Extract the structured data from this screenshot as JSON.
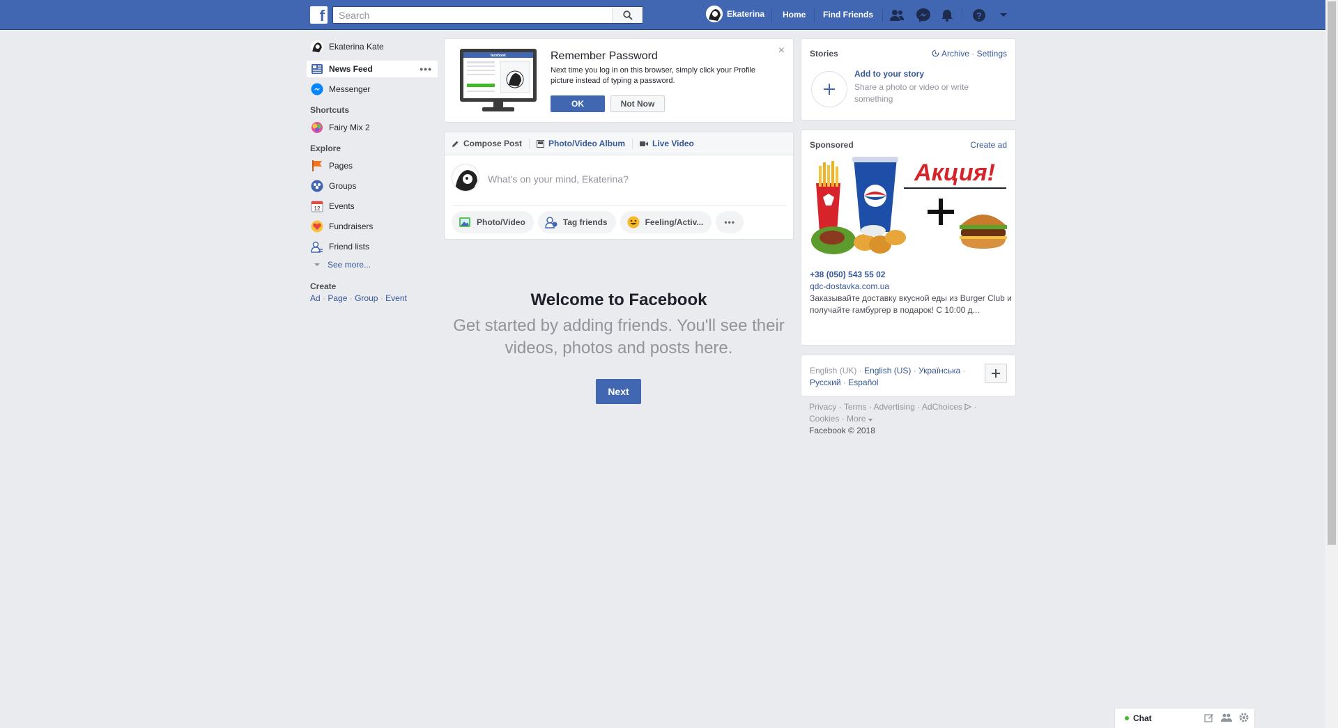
{
  "header": {
    "logo": "f",
    "search_placeholder": "Search",
    "user_name": "Ekaterina",
    "home": "Home",
    "find_friends": "Find Friends",
    "brand_color": "#4267b2"
  },
  "sidebar": {
    "profile_name": "Ekaterina Kate",
    "items": [
      {
        "label": "News Feed",
        "icon": "news-feed-icon"
      },
      {
        "label": "Messenger",
        "icon": "messenger-icon"
      }
    ],
    "shortcuts_heading": "Shortcuts",
    "shortcuts": [
      {
        "label": "Fairy Mix 2",
        "icon": "game-icon"
      }
    ],
    "explore_heading": "Explore",
    "explore": [
      {
        "label": "Pages",
        "icon": "flag-icon"
      },
      {
        "label": "Groups",
        "icon": "groups-icon"
      },
      {
        "label": "Events",
        "icon": "calendar-icon"
      },
      {
        "label": "Fundraisers",
        "icon": "heart-icon"
      },
      {
        "label": "Friend lists",
        "icon": "friends-icon"
      }
    ],
    "see_more": "See more...",
    "create_heading": "Create",
    "create_links": [
      "Ad",
      "Page",
      "Group",
      "Event"
    ],
    "separator": "·"
  },
  "remember_password": {
    "title": "Remember Password",
    "description": "Next time you log in on this browser, simply click your Profile picture instead of typing a password.",
    "ok": "OK",
    "not_now": "Not Now",
    "close": "×",
    "monitor_brand": "facebook"
  },
  "composer": {
    "tabs": [
      "Compose Post",
      "Photo/Video Album",
      "Live Video"
    ],
    "placeholder": "What's on your mind, Ekaterina?",
    "actions": [
      "Photo/Video",
      "Tag friends",
      "Feeling/Activ..."
    ],
    "more": "•••"
  },
  "welcome": {
    "title": "Welcome to Facebook",
    "subtitle": "Get started by adding friends. You'll see their videos, photos and posts here.",
    "next": "Next"
  },
  "stories": {
    "heading": "Stories",
    "archive": "Archive",
    "settings": "Settings",
    "add_title": "Add to your story",
    "add_desc": "Share a photo or video or write something"
  },
  "sponsored": {
    "heading": "Sponsored",
    "create_ad": "Create ad",
    "ad_headline": "Акция!",
    "phone": "+38 (050) 543 55 02",
    "domain": "qdc-dostavka.com.ua",
    "text": "Заказывайте доставку вкусной еды из Burger Club и получайте гамбургер в подарок! С 10:00 д..."
  },
  "languages": {
    "current": "English (UK)",
    "others": [
      "English (US)",
      "Українська",
      "Русский",
      "Español"
    ]
  },
  "footer": {
    "links": [
      "Privacy",
      "Terms",
      "Advertising",
      "AdChoices",
      "Cookies",
      "More"
    ],
    "copyright": "Facebook © 2018"
  },
  "chat": {
    "label": "Chat"
  }
}
